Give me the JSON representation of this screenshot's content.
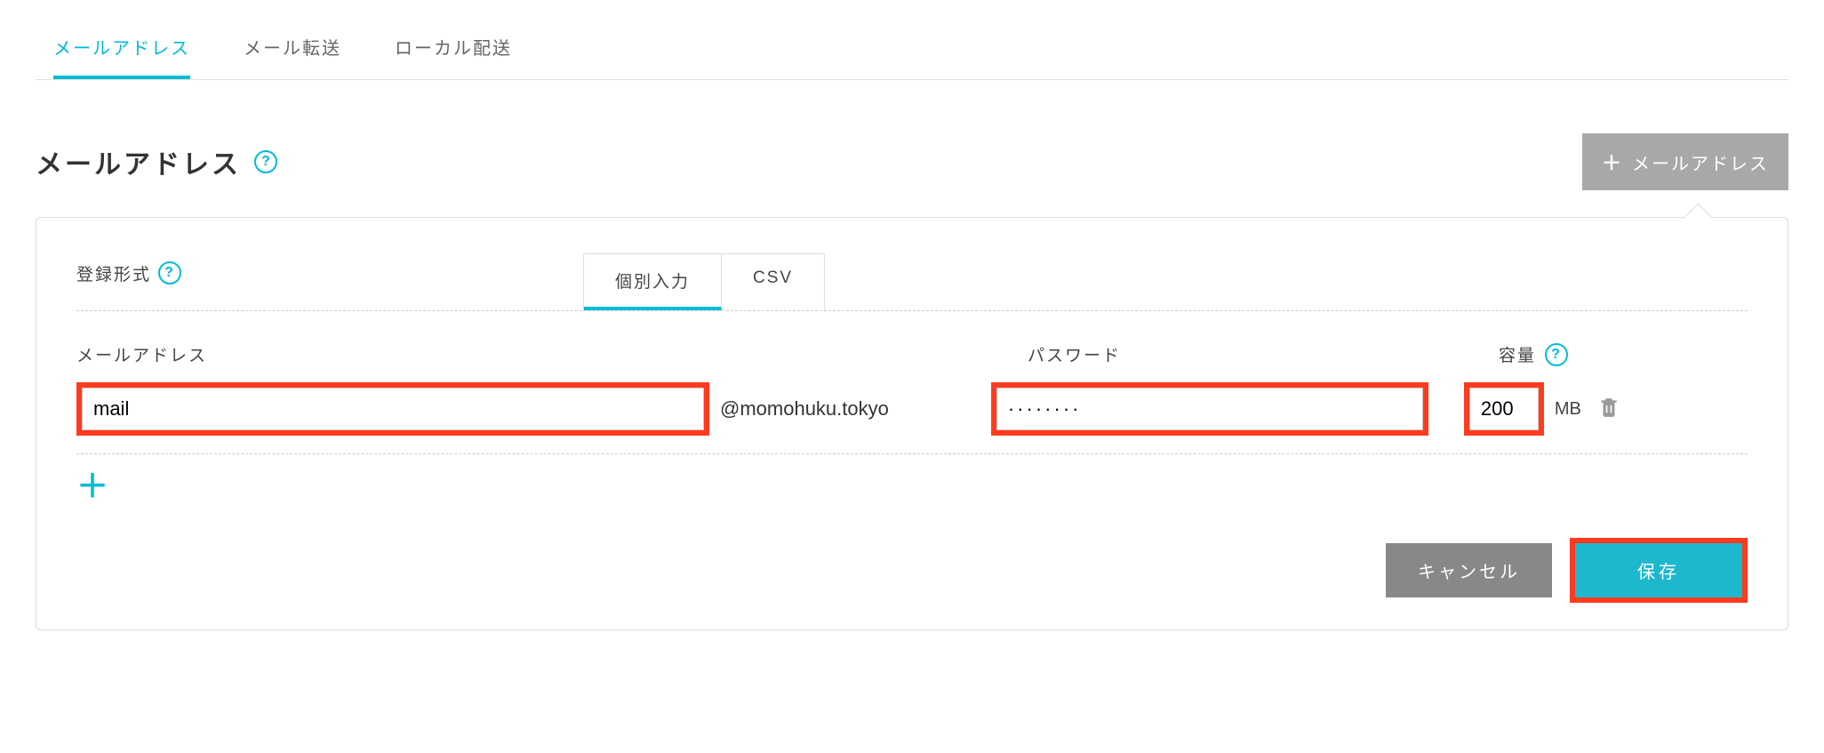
{
  "tabs": {
    "mail_address": "メールアドレス",
    "mail_forward": "メール転送",
    "local_delivery": "ローカル配送"
  },
  "header": {
    "title": "メールアドレス",
    "add_button": "メールアドレス"
  },
  "form": {
    "reg_type_label": "登録形式",
    "sub_tabs": {
      "individual": "個別入力",
      "csv": "CSV"
    },
    "labels": {
      "email": "メールアドレス",
      "password": "パスワード",
      "capacity": "容量"
    },
    "row": {
      "email_value": "mail",
      "domain": "@momohuku.tokyo",
      "password_value": "········",
      "capacity_value": "200",
      "capacity_unit": "MB"
    },
    "buttons": {
      "cancel": "キャンセル",
      "save": "保存"
    }
  }
}
